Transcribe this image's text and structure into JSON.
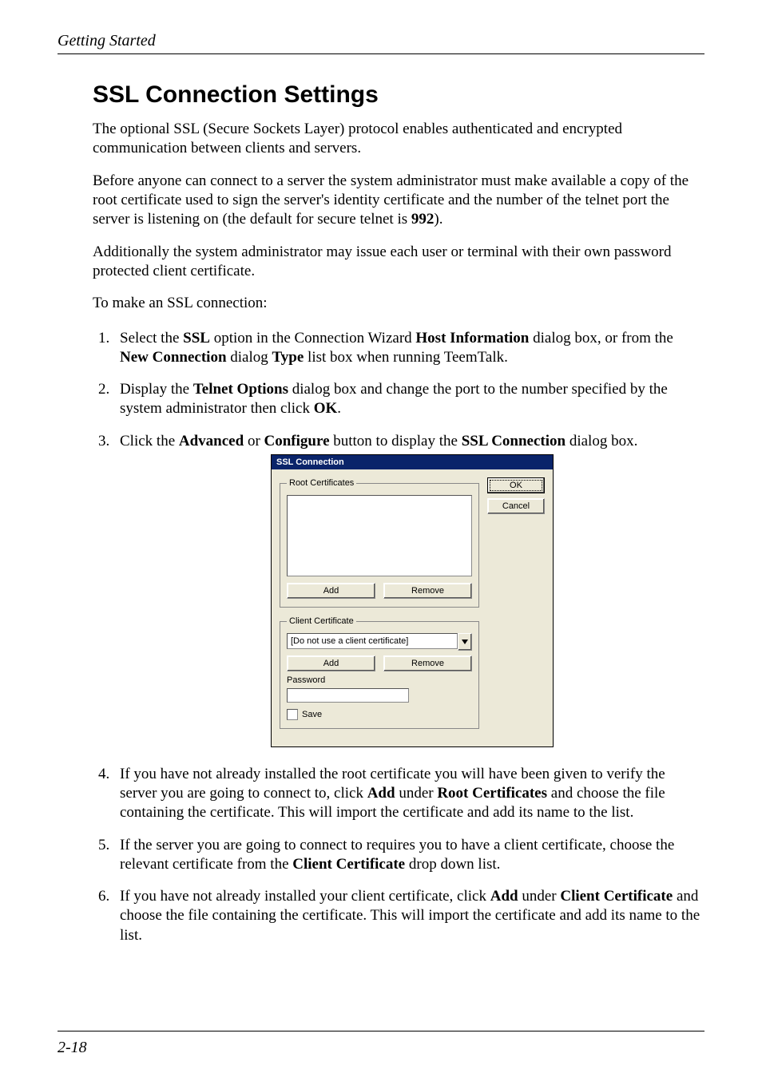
{
  "running_head": "Getting Started",
  "page_number": "2-18",
  "title": "SSL Connection Settings",
  "paragraphs": {
    "p1": "The optional SSL (Secure Sockets Layer) protocol enables authenticated and encrypted communication between clients and servers.",
    "p2a": "Before anyone can connect to a server the system administrator must make available a copy of the root certificate used to sign the server's identity certificate and the number of the telnet port the server is listening on (the default for secure telnet is ",
    "p2_bold": "992",
    "p2b": ").",
    "p3": "Additionally the system administrator may issue each user or terminal with their own password protected client certificate.",
    "p4": "To make an SSL connection:"
  },
  "steps": {
    "s1": {
      "a": "Select the ",
      "b1": "SSL",
      "c": " option in the Connection Wizard ",
      "b2": "Host Information",
      "d": " dialog box, or from the ",
      "b3": "New Connection",
      "e": " dialog ",
      "b4": "Type",
      "f": " list box when running TeemTalk."
    },
    "s2": {
      "a": "Display the ",
      "b1": "Telnet Options",
      "c": " dialog box and change the port to the number specified by the system administrator then click ",
      "b2": "OK",
      "d": "."
    },
    "s3": {
      "a": "Click the ",
      "b1": "Advanced",
      "c": " or ",
      "b2": "Configure",
      "d": " button to display the ",
      "b3": "SSL Connection",
      "e": " dialog box."
    },
    "s4": {
      "a": "If you have not already installed the root certificate you will have been given to verify the server you are going to connect to, click ",
      "b1": "Add",
      "c": " under ",
      "b2": "Root Certificates",
      "d": " and choose the file containing the certificate. This will import the certificate and add its name to the list."
    },
    "s5": {
      "a": "If the server you are going to connect to requires you to have a client certificate, choose the relevant certificate from the ",
      "b1": "Client Certificate",
      "c": " drop down list."
    },
    "s6": {
      "a": "If you have not already installed your client certificate, click ",
      "b1": "Add",
      "c": " under ",
      "b2": "Client Certificate",
      "d": " and choose the file containing the certificate. This will import the certificate and add its name to the list."
    }
  },
  "dialog": {
    "title": "SSL Connection",
    "ok": "OK",
    "cancel": "Cancel",
    "root_group": "Root Certificates",
    "client_group": "Client Certificate",
    "add": "Add",
    "remove": "Remove",
    "combo_value": "[Do not use a client certificate]",
    "password_label": "Password",
    "save_label": "Save"
  }
}
